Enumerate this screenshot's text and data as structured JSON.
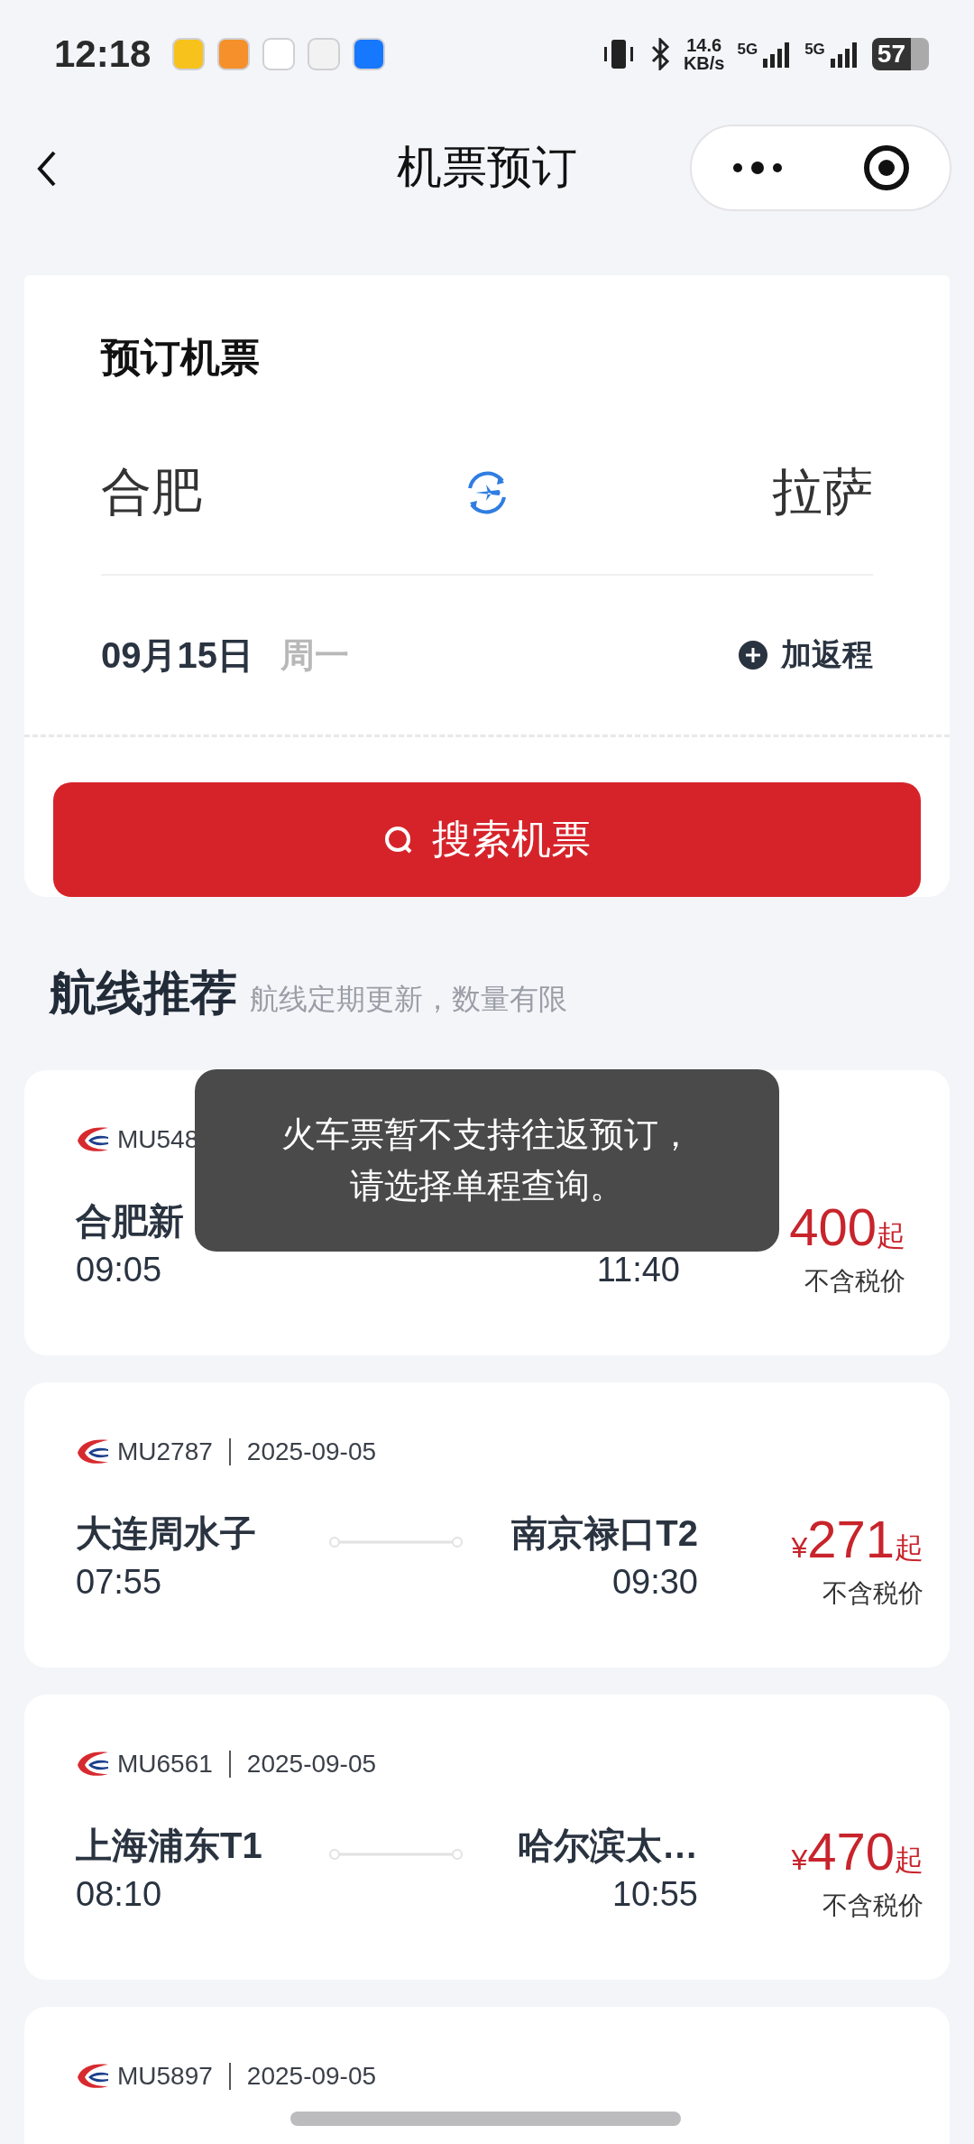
{
  "status_bar": {
    "time": "12:18",
    "net_speed": "14.6",
    "net_unit": "KB/s",
    "signals": [
      "5G",
      "5G"
    ],
    "battery": "57"
  },
  "nav": {
    "title": "机票预订"
  },
  "booking": {
    "title": "预订机票",
    "from": "合肥",
    "to": "拉萨",
    "date": "09月15日",
    "weekday": "周一",
    "add_return": "加返程",
    "search_button": "搜索机票"
  },
  "routes": {
    "title": "航线推荐",
    "subtitle": "航线定期更新，数量有限",
    "flights": [
      {
        "flight": "MU548",
        "from": "合肥新",
        "dep": "09:05",
        "arr": "11:40",
        "price": "400",
        "suffix": "起",
        "note": "不含税价"
      },
      {
        "flight": "MU2787",
        "date": "2025-09-05",
        "from": "大连周水子",
        "to": "南京禄口T2",
        "dep": "07:55",
        "arr": "09:30",
        "currency": "¥",
        "price": "271",
        "suffix": "起",
        "note": "不含税价"
      },
      {
        "flight": "MU6561",
        "date": "2025-09-05",
        "from": "上海浦东T1",
        "to": "哈尔滨太…",
        "dep": "08:10",
        "arr": "10:55",
        "currency": "¥",
        "price": "470",
        "suffix": "起",
        "note": "不含税价"
      },
      {
        "flight": "MU5897",
        "date": "2025-09-05"
      }
    ]
  },
  "toast": {
    "message": "火车票暂不支持往返预订，请选择单程查询。"
  }
}
